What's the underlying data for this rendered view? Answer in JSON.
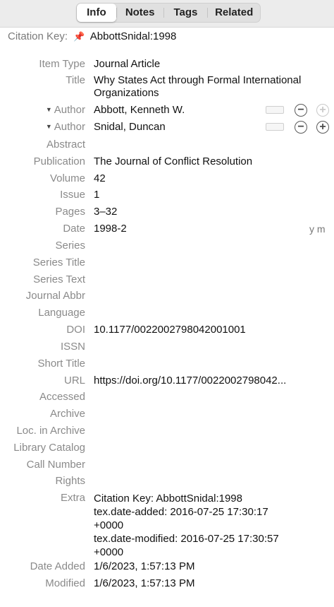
{
  "tabs": [
    "Info",
    "Notes",
    "Tags",
    "Related"
  ],
  "citation_key": {
    "label": "Citation Key:",
    "value": "AbbottSnidal:1998"
  },
  "fields": {
    "item_type": {
      "label": "Item Type",
      "value": "Journal Article"
    },
    "title": {
      "label": "Title",
      "value": "Why States Act through Formal International Organizations"
    },
    "author1": {
      "label": "Author",
      "value": "Abbott, Kenneth W."
    },
    "author2": {
      "label": "Author",
      "value": "Snidal, Duncan"
    },
    "abstract": {
      "label": "Abstract",
      "value": ""
    },
    "publication": {
      "label": "Publication",
      "value": "The Journal of Conflict Resolution"
    },
    "volume": {
      "label": "Volume",
      "value": "42"
    },
    "issue": {
      "label": "Issue",
      "value": "1"
    },
    "pages": {
      "label": "Pages",
      "value": "3–32"
    },
    "date": {
      "label": "Date",
      "value": "1998-2",
      "hint": "y m"
    },
    "series": {
      "label": "Series",
      "value": ""
    },
    "series_title": {
      "label": "Series Title",
      "value": ""
    },
    "series_text": {
      "label": "Series Text",
      "value": ""
    },
    "journal_abbr": {
      "label": "Journal Abbr",
      "value": ""
    },
    "language": {
      "label": "Language",
      "value": ""
    },
    "doi": {
      "label": "DOI",
      "value": "10.1177/0022002798042001001"
    },
    "issn": {
      "label": "ISSN",
      "value": ""
    },
    "short_title": {
      "label": "Short Title",
      "value": ""
    },
    "url": {
      "label": "URL",
      "value": "https://doi.org/10.1177/0022002798042..."
    },
    "accessed": {
      "label": "Accessed",
      "value": ""
    },
    "archive": {
      "label": "Archive",
      "value": ""
    },
    "loc_in_archive": {
      "label": "Loc. in Archive",
      "value": ""
    },
    "library_catalog": {
      "label": "Library Catalog",
      "value": ""
    },
    "call_number": {
      "label": "Call Number",
      "value": ""
    },
    "rights": {
      "label": "Rights",
      "value": ""
    },
    "extra": {
      "label": "Extra",
      "value": "Citation Key: AbbottSnidal:1998\ntex.date-added: 2016-07-25 17:30:17\n+0000\ntex.date-modified: 2016-07-25 17:30:57\n+0000"
    },
    "date_added": {
      "label": "Date Added",
      "value": "1/6/2023, 1:57:13 PM"
    },
    "modified": {
      "label": "Modified",
      "value": "1/6/2023, 1:57:13 PM"
    }
  },
  "icons": {
    "pin": "pin-icon",
    "disclosure": "triangle-down-icon",
    "remove": "minus-circle-icon",
    "add": "plus-circle-icon"
  }
}
